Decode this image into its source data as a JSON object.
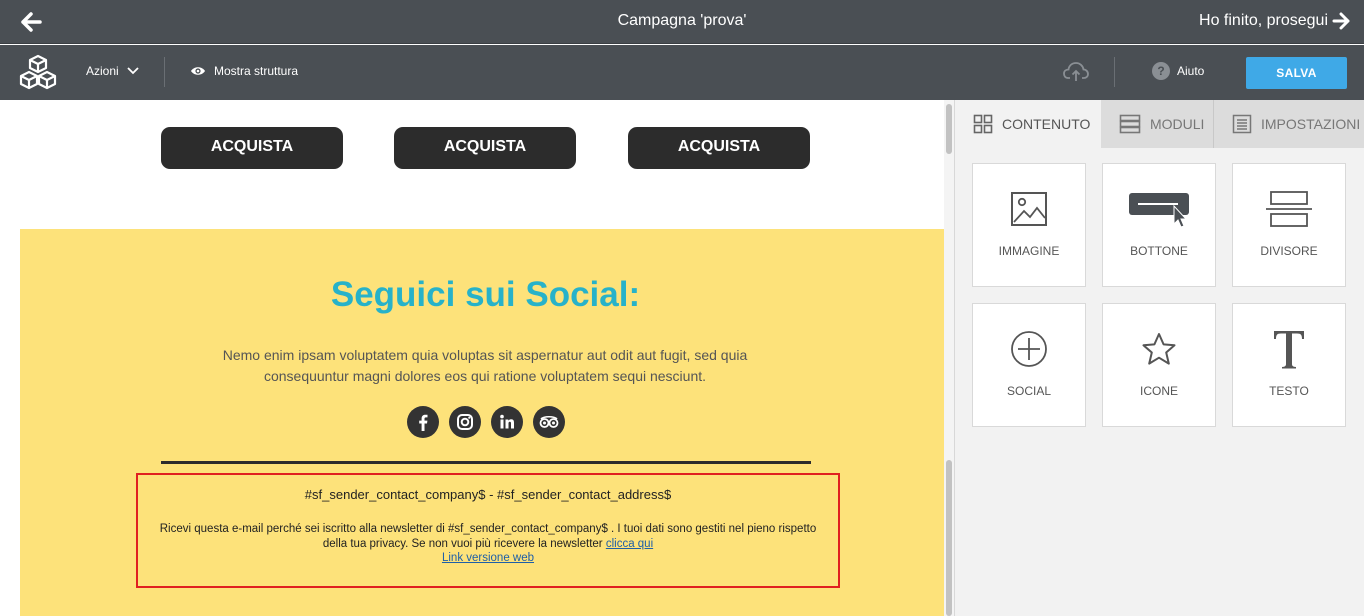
{
  "topbar": {
    "title": "Campagna 'prova'",
    "finish_label": "Ho finito, prosegui",
    "icons": [
      "arrow-left-icon",
      "arrow-right-icon"
    ]
  },
  "toolbar": {
    "actions_label": "Azioni",
    "show_structure_label": "Mostra struttura",
    "help_label": "Aiuto",
    "help_symbol": "?",
    "save_label": "SALVA",
    "save_color": "#3fa9e7",
    "bar_color": "#4a4f54"
  },
  "canvas": {
    "buy_buttons": [
      "ACQUISTA",
      "ACQUISTA",
      "ACQUISTA"
    ],
    "social": {
      "title": "Seguici sui Social:",
      "text": "Nemo enim ipsam voluptatem quia voluptas sit aspernatur aut odit aut fugit, sed quia consequuntur magni dolores eos qui ratione voluptatem sequi nesciunt.",
      "icons": [
        "facebook-icon",
        "instagram-icon",
        "linkedin-icon",
        "tripadvisor-icon"
      ],
      "background_color": "#fde27a",
      "title_color": "#27b2c9"
    },
    "footer": {
      "address": "#sf_sender_contact_company$  -  #sf_sender_contact_address$",
      "notice_before_link": "Ricevi questa e-mail perché sei iscritto alla newsletter di #sf_sender_contact_company$ . I tuoi dati sono gestiti nel pieno rispetto della tua privacy. Se non vuoi più ricevere la newsletter ",
      "unsubscribe_link": "clicca qui",
      "web_version_link": "Link versione web",
      "highlight_color": "#e02020"
    }
  },
  "panel": {
    "tabs": [
      {
        "label": "CONTENUTO",
        "icon": "grid-icon",
        "active": true
      },
      {
        "label": "MODULI",
        "icon": "modules-icon",
        "active": false
      },
      {
        "label": "IMPOSTAZIONI",
        "icon": "settings-list-icon",
        "active": false
      }
    ],
    "blocks": [
      {
        "label": "IMMAGINE",
        "icon": "image-icon"
      },
      {
        "label": "BOTTONE",
        "icon": "button-icon"
      },
      {
        "label": "DIVISORE",
        "icon": "divider-icon"
      },
      {
        "label": "SOCIAL",
        "icon": "plus-circle-icon"
      },
      {
        "label": "ICONE",
        "icon": "star-icon"
      },
      {
        "label": "TESTO",
        "icon": "text-icon"
      }
    ]
  }
}
